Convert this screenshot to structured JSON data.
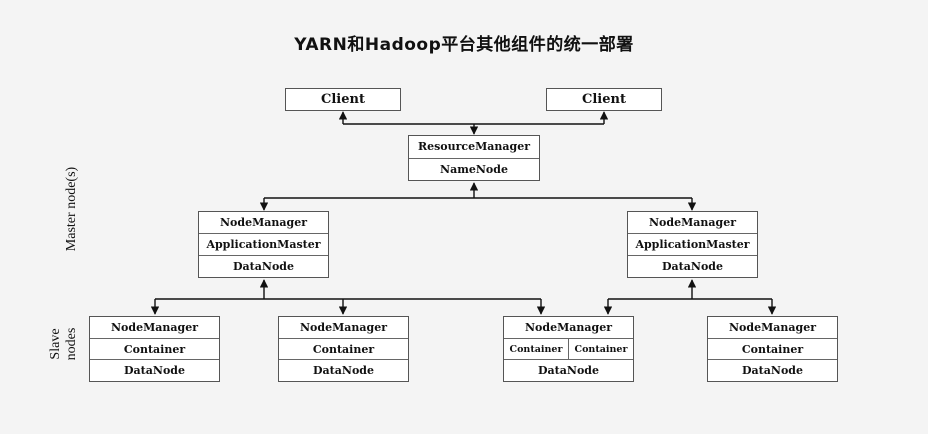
{
  "title": "YARN和Hadoop平台其他组件的统一部署",
  "labels": {
    "master": "Master node(s)",
    "slave_line1": "Slave",
    "slave_line2": "nodes"
  },
  "clients": [
    {
      "label": "Client"
    },
    {
      "label": "Client"
    }
  ],
  "resource_manager": {
    "rows": [
      "ResourceManager",
      "NameNode"
    ]
  },
  "mid_nodes": [
    {
      "rows": [
        "NodeManager",
        "ApplicationMaster",
        "DataNode"
      ]
    },
    {
      "rows": [
        "NodeManager",
        "ApplicationMaster",
        "DataNode"
      ]
    }
  ],
  "slave_nodes": [
    {
      "rows": [
        "NodeManager",
        "Container",
        "DataNode"
      ]
    },
    {
      "rows": [
        "NodeManager",
        "Container",
        "DataNode"
      ]
    },
    {
      "rows": [
        "NodeManager",
        "DataNode"
      ],
      "containers": [
        "Container",
        "Container"
      ]
    },
    {
      "rows": [
        "NodeManager",
        "Container",
        "DataNode"
      ]
    }
  ]
}
